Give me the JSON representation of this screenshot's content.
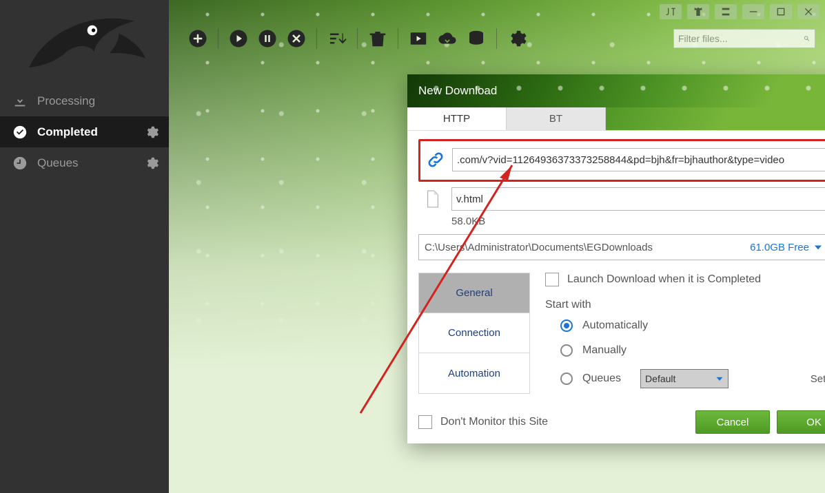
{
  "sidebar": {
    "items": [
      {
        "label": "Processing"
      },
      {
        "label": "Completed"
      },
      {
        "label": "Queues"
      }
    ]
  },
  "filter": {
    "placeholder": "Filter files..."
  },
  "dialog": {
    "title": "New Download",
    "tabs": {
      "http": "HTTP",
      "bt": "BT"
    },
    "url": ".com/v?vid=11264936373373258844&pd=bjh&fr=bjhauthor&type=video",
    "filename": "v.html",
    "size": "58.0KB",
    "path": "C:\\Users\\Administrator\\Documents\\EGDownloads",
    "free": "61.0GB Free",
    "vtabs": {
      "general": "General",
      "connection": "Connection",
      "automation": "Automation"
    },
    "launch": "Launch Download when it is Completed",
    "start_with_label": "Start with",
    "opts": {
      "auto": "Automatically",
      "manual": "Manually",
      "queues": "Queues"
    },
    "queue_default": "Default",
    "setting": "Setting...",
    "dont_monitor": "Don't Monitor this Site",
    "cancel": "Cancel",
    "ok": "OK"
  }
}
